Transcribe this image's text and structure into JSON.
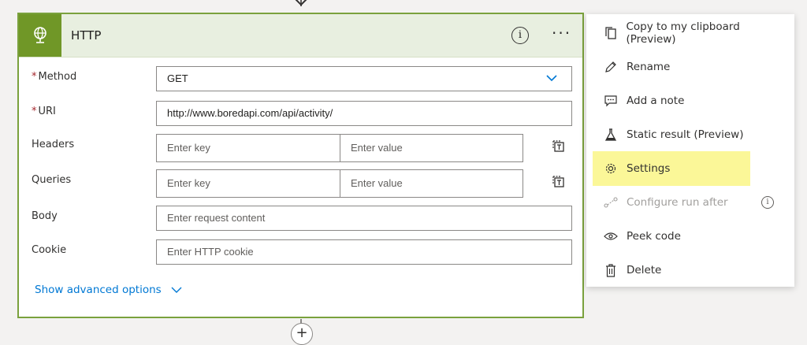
{
  "card": {
    "title": "HTTP",
    "info_glyph": "i",
    "more_glyph": "···",
    "icon": "globe-icon",
    "accent": "#709727",
    "fields": {
      "method": {
        "label": "Method",
        "required_mark": "*",
        "value": "GET"
      },
      "uri": {
        "label": "URI",
        "required_mark": "*",
        "value": "http://www.boredapi.com/api/activity/"
      },
      "headers": {
        "label": "Headers",
        "key_placeholder": "Enter key",
        "value_placeholder": "Enter value"
      },
      "queries": {
        "label": "Queries",
        "key_placeholder": "Enter key",
        "value_placeholder": "Enter value"
      },
      "body": {
        "label": "Body",
        "placeholder": "Enter request content"
      },
      "cookie": {
        "label": "Cookie",
        "placeholder": "Enter HTTP cookie"
      }
    },
    "advanced_label": "Show advanced options"
  },
  "add_step_glyph": "+",
  "menu": {
    "items": [
      {
        "label": "Copy to my clipboard (Preview)",
        "icon": "copy-icon"
      },
      {
        "label": "Rename",
        "icon": "pencil-icon"
      },
      {
        "label": "Add a note",
        "icon": "comment-icon"
      },
      {
        "label": "Static result (Preview)",
        "icon": "flask-icon"
      },
      {
        "label": "Settings",
        "icon": "gear-icon",
        "highlighted": true
      },
      {
        "label": "Configure run after",
        "icon": "run-after-icon",
        "disabled": true
      },
      {
        "label": "Peek code",
        "icon": "eye-icon"
      },
      {
        "label": "Delete",
        "icon": "trash-icon"
      }
    ],
    "info_glyph": "i",
    "highlight_color": "#fbf798"
  }
}
